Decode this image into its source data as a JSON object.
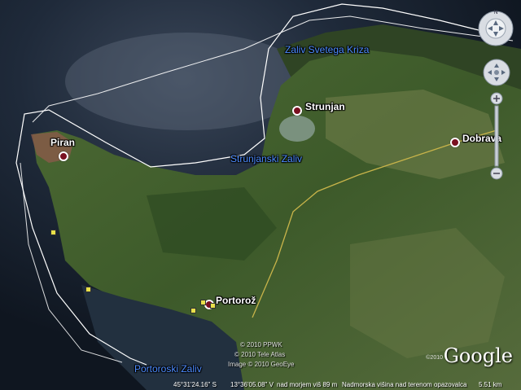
{
  "places": {
    "piran": "Piran",
    "strunjan": "Strunjan",
    "dobrava": "Dobrava",
    "portoroz": "Portorož"
  },
  "bays": {
    "zaliv_svetega_kriza": "Zaliv Svetega Kriza",
    "strunjanski_zaliv": "Strunjanski Zaliv",
    "portoroski_zaliv": "Portoroski Zaliv"
  },
  "copyright": {
    "line1": "© 2010 PPWK",
    "line2": "© 2010 Tele Atlas",
    "line3": "Image © 2010 GeoEye"
  },
  "logo": {
    "text": "Google",
    "year": "©2010"
  },
  "status_bar": {
    "coordinates": "45°31'24.16\" S",
    "coordinates2": "13°36'05.08\" V",
    "elevation": "nad morjem  viš   89 m",
    "eye_altitude": "Nadmorska višina nad terenom opazovalca",
    "eye_value": "5.51 km"
  },
  "colors": {
    "sea": "#1b2433",
    "land": "#3f5a2c",
    "bay_label": "#4d8cff",
    "pin": "#7a1020",
    "route": "#ffffff",
    "road": "#c8b44a"
  },
  "controls": {
    "look_icon": "look-around-icon",
    "move_icon": "move-icon",
    "zoom_in_icon": "plus-icon",
    "zoom_out_icon": "minus-icon",
    "north_label": "N"
  }
}
